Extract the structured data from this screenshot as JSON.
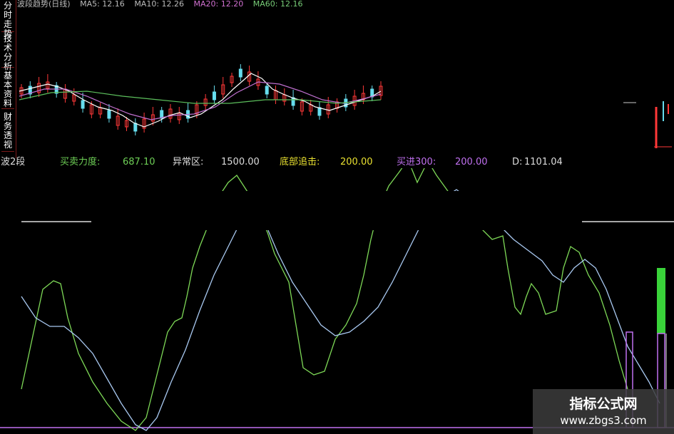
{
  "sidebar": {
    "tabs": [
      {
        "label": "分时走势"
      },
      {
        "label": "技术分析"
      },
      {
        "label": "基本资料"
      },
      {
        "label": "财务透视"
      }
    ]
  },
  "top_strip": {
    "items": [
      "波段趋势(日线)",
      "MA5: 12.16",
      "MA10: 12.26",
      "MA20: 12.20",
      "MA60: 12.16"
    ]
  },
  "indicator_bar": {
    "name": "波2段",
    "power_label": "买卖力度:",
    "power_value": "687.10",
    "abnormal_label": "异常区:",
    "abnormal_value": "1500.00",
    "bottom_label": "底部追击:",
    "bottom_value": "200.00",
    "buy_label": "买进300:",
    "buy_value": "200.00",
    "d_label": "D:",
    "d_value": "1101.04"
  },
  "watermark": {
    "title": "指标公式网",
    "url": "www.zbgs3.com"
  },
  "colors": {
    "background": "#000000",
    "green_line": "#7ed957",
    "blue_line": "#a8c8f0",
    "purple": "#c070f0",
    "bar_green": "#3ad33a",
    "candle_red": "#ff3838",
    "candle_cyan": "#66ddee",
    "yellow_label": "#e8e030"
  }
}
